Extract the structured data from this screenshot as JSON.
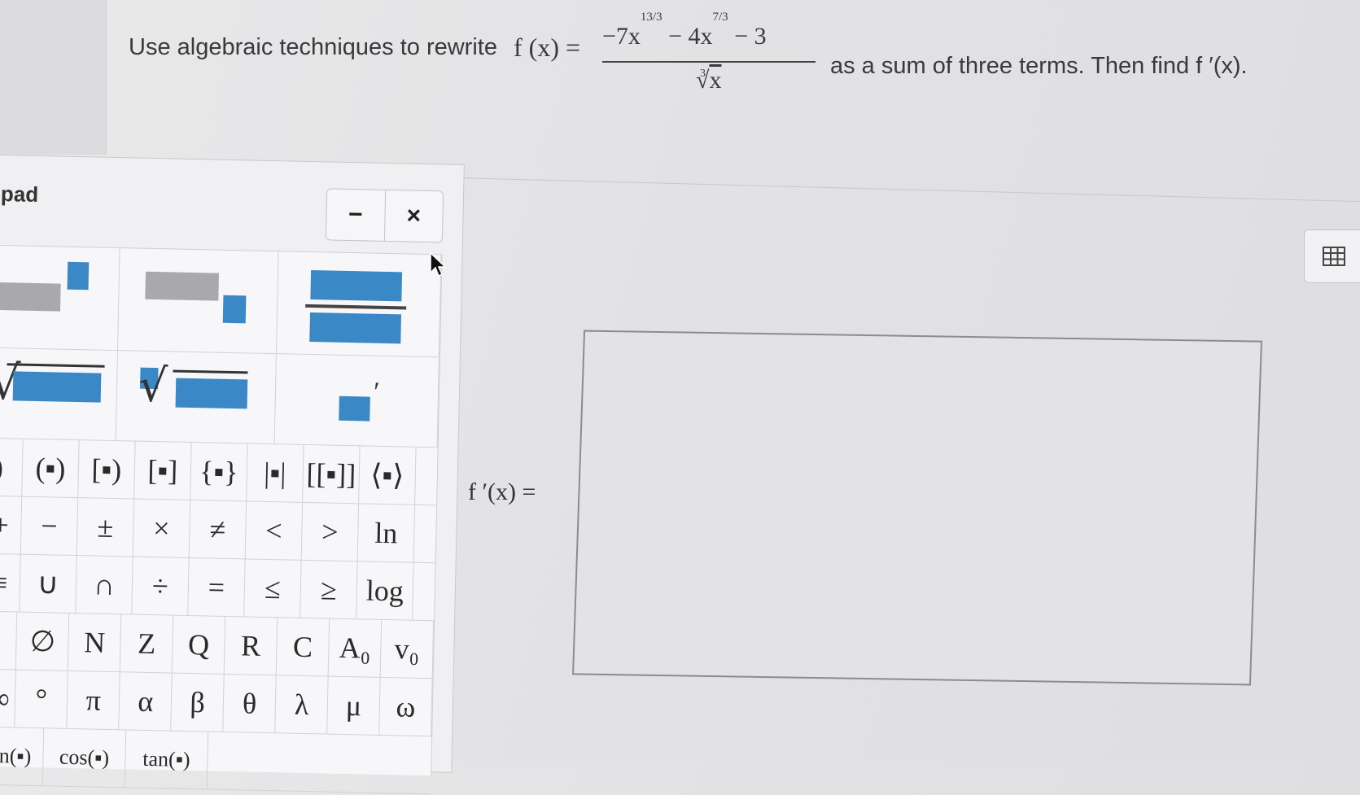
{
  "question": {
    "prefix": "Use algebraic techniques to rewrite",
    "function_label": "f (x) =",
    "numerator": {
      "term1_coef": "−7x",
      "term1_exp": "13/3",
      "term2_coef": "− 4x",
      "term2_exp": "7/3",
      "term3": "− 3"
    },
    "denominator": {
      "root_index": "3",
      "radicand": "x"
    },
    "suffix": "as a sum of three terms. Then find f ′(x)."
  },
  "keypad": {
    "title": "pad",
    "minimize_label": "−",
    "close_label": "×",
    "row_brackets": [
      ")",
      "(▪)",
      "[▪)",
      "[▪]",
      "{▪}",
      "|▪|",
      "[[▪]]",
      "⟨▪⟩"
    ],
    "row_ops": [
      "+",
      "−",
      "±",
      "×",
      "≠",
      "<",
      ">",
      "ln"
    ],
    "row_sets": [
      "≡",
      "∪",
      "∩",
      "÷",
      "=",
      "≤",
      "≥",
      "log"
    ],
    "row_letters": [
      "|",
      "∅",
      "N",
      "Z",
      "Q",
      "R",
      "C",
      "A₀",
      "v₀"
    ],
    "row_greek": [
      "∞",
      "°",
      "π",
      "α",
      "β",
      "θ",
      "λ",
      "μ",
      "ω"
    ],
    "row_trig": [
      "n(▪)",
      "cos(▪)",
      "tan(▪)"
    ]
  },
  "answer": {
    "label": "f ′(x) =",
    "value": ""
  },
  "icons": {
    "grid": "table-grid-icon",
    "cursor": "mouse-pointer-icon"
  },
  "colors": {
    "template_blue": "#3a88c6",
    "template_gray": "#a9a9ab"
  }
}
